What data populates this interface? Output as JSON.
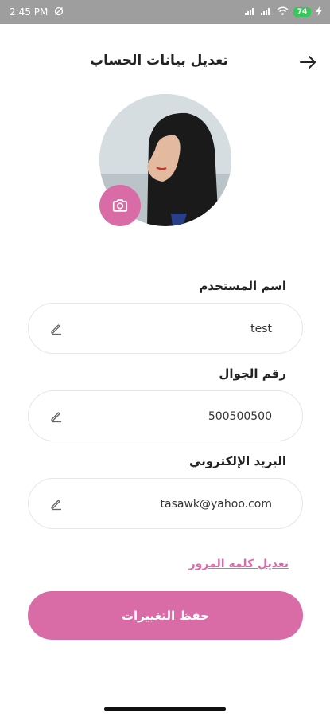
{
  "status_bar": {
    "time": "2:45 PM",
    "battery": "74",
    "icons": [
      "sync-off-icon",
      "signal-icon",
      "wifi-icon",
      "battery-icon",
      "charging-icon"
    ]
  },
  "header": {
    "title": "تعديل بيانات الحساب",
    "back_icon": "arrow-right-icon"
  },
  "profile": {
    "camera_icon": "camera-icon"
  },
  "form": {
    "username_label": "اسم المستخدم",
    "username_value": "test",
    "phone_label": "رقم الجوال",
    "phone_value": "500500500",
    "email_label": "البريد الإلكتروني",
    "email_value": "tasawk@yahoo.com",
    "edit_icon": "pencil-icon"
  },
  "change_password": "تعديل كلمة المرور",
  "save_button": "حفظ التغييرات",
  "colors": {
    "accent": "#d96ba6",
    "status_bar": "#9e9e9e"
  }
}
